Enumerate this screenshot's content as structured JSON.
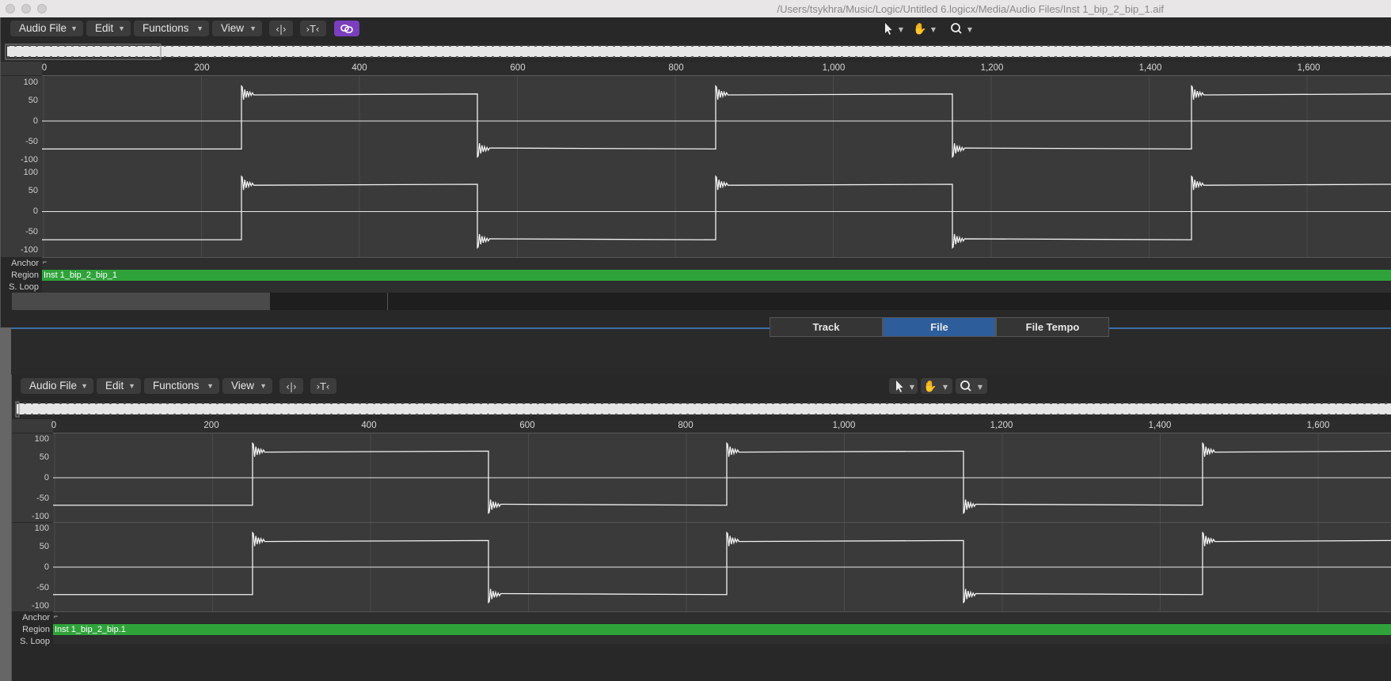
{
  "window": {
    "title": "/Users/tsykhra/Music/Logic/Untitled 6.logicx/Media/Audio Files/Inst 1_bip_2_bip_1.aif"
  },
  "top_editor": {
    "menus": [
      "Audio File",
      "Edit",
      "Functions",
      "View"
    ],
    "ruler": [
      "0",
      "200",
      "400",
      "600",
      "800",
      "1,000",
      "1,200",
      "1,400",
      "1,600"
    ],
    "y_ticks": [
      "100",
      "50",
      "0",
      "-50",
      "-100"
    ],
    "lanes": {
      "anchor": "Anchor",
      "region": "Region",
      "sloop": "S. Loop"
    },
    "region_name": "Inst 1_bip_2_bip_1"
  },
  "bottom_editor": {
    "tabs": [
      "Track",
      "File",
      "File Tempo"
    ],
    "active_tab": "File",
    "menus": [
      "Audio File",
      "Edit",
      "Functions",
      "View"
    ],
    "ruler": [
      "0",
      "200",
      "400",
      "600",
      "800",
      "1,000",
      "1,200",
      "1,400",
      "1,600"
    ],
    "y_ticks": [
      "100",
      "50",
      "0",
      "-50",
      "-100"
    ],
    "lanes": {
      "anchor": "Anchor",
      "region": "Region",
      "sloop": "S. Loop"
    },
    "region_name": "Inst 1_bip_2_bip.1"
  },
  "colors": {
    "accent": "#2d5d9b",
    "region": "#2fa33a",
    "link": "#7a3fbf"
  }
}
